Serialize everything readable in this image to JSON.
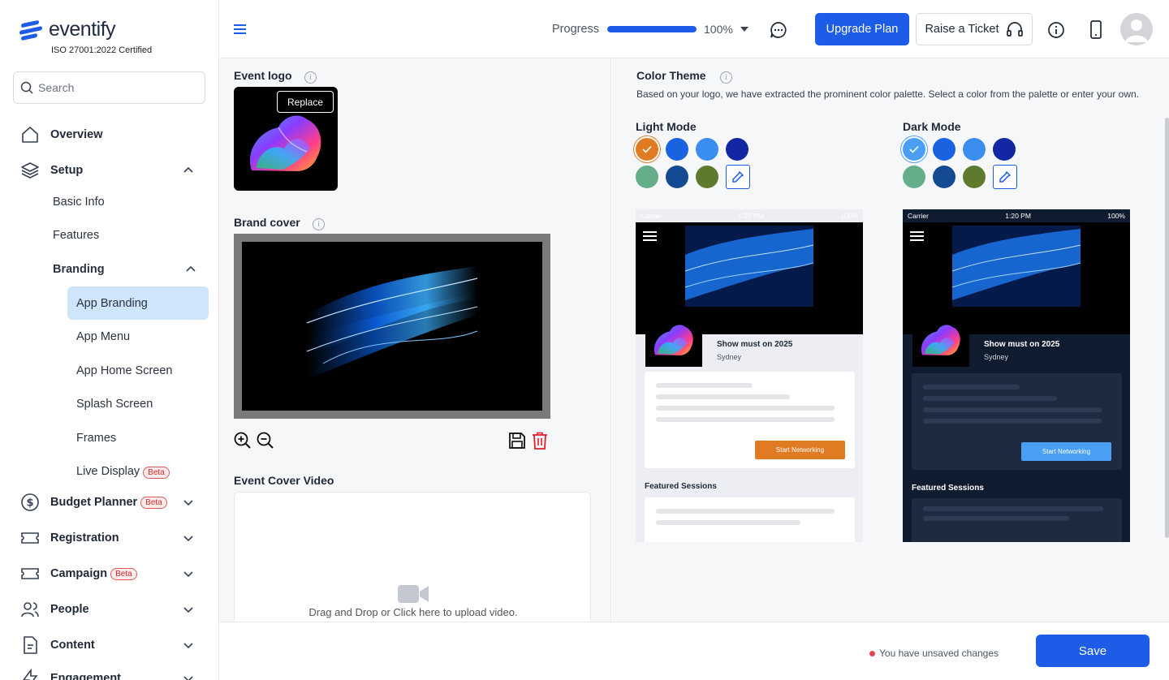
{
  "brand": {
    "name": "eventify",
    "cert": "ISO 27001:2022 Certified",
    "color": "#1d5ce6"
  },
  "search": {
    "placeholder": "Search"
  },
  "nav": {
    "overview": "Overview",
    "setup": "Setup",
    "basic_info": "Basic Info",
    "features": "Features",
    "branding": "Branding",
    "app_branding": "App Branding",
    "app_menu": "App Menu",
    "app_home": "App Home Screen",
    "splash": "Splash Screen",
    "frames": "Frames",
    "live_display": "Live Display",
    "budget": "Budget Planner",
    "registration": "Registration",
    "campaign": "Campaign",
    "people": "People",
    "content": "Content",
    "engagement": "Engagement",
    "beta": "Beta"
  },
  "topbar": {
    "progress_label": "Progress",
    "progress_value": 1.0,
    "progress_text": "100%",
    "upgrade": "Upgrade Plan",
    "ticket": "Raise a Ticket"
  },
  "left": {
    "event_logo": "Event logo",
    "replace": "Replace",
    "brand_cover": "Brand cover",
    "cover_video": "Event Cover Video",
    "upload_text": "Drag and Drop or Click here to upload video."
  },
  "theme": {
    "title": "Color Theme",
    "desc": "Based on your logo, we have extracted the prominent color palette. Select a color from the palette or enter your own.",
    "light_label": "Light Mode",
    "dark_label": "Dark Mode",
    "light_colors": [
      "#e07b24",
      "#1a63e0",
      "#3a8ef0",
      "#1427a3",
      "#66ad8a",
      "#134a91",
      "#5d7a2e"
    ],
    "dark_colors": [
      "#4a9ff5",
      "#1a63e0",
      "#3a8ef0",
      "#1427a3",
      "#66ad8a",
      "#134a91",
      "#5d7a2e"
    ]
  },
  "preview": {
    "carrier": "Carrier",
    "time": "1:20 PM",
    "battery": "100%",
    "event_title": "Show must on 2025",
    "city": "Sydney",
    "button": "Start Networking",
    "featured": "Featured Sessions",
    "light_accent": "#e07b24",
    "dark_accent": "#4a9ff5"
  },
  "footer": {
    "unsaved": "You have unsaved changes",
    "save": "Save"
  }
}
